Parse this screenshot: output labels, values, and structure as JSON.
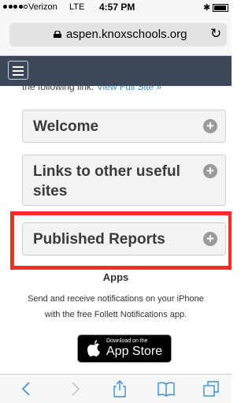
{
  "status_bar": {
    "carrier": "Verizon",
    "network": "LTE",
    "time": "4:57 PM"
  },
  "url_bar": {
    "domain": "aspen.knoxschools.org",
    "reload_icon": "reload-icon"
  },
  "content": {
    "intro_text": "the following link:",
    "intro_link": "View Full Site »",
    "panels": [
      {
        "title_line1": "Welcome",
        "icon": "plus-icon"
      },
      {
        "title_line1": "Links to other useful",
        "title_line2": "sites",
        "icon": "plus-icon"
      },
      {
        "title_line1": "Published Reports",
        "icon": "plus-icon"
      }
    ],
    "apps_heading": "Apps",
    "apps_text_line1": "Send and receive notifications on your iPhone",
    "apps_text_line2": "with the free Follett Notifications app.",
    "badge_small": "Download on the",
    "badge_big": "App Store"
  },
  "colors": {
    "header": "#3c4858",
    "highlight": "#ff2a2a",
    "toolbar_tint": "#3b8fd0"
  }
}
